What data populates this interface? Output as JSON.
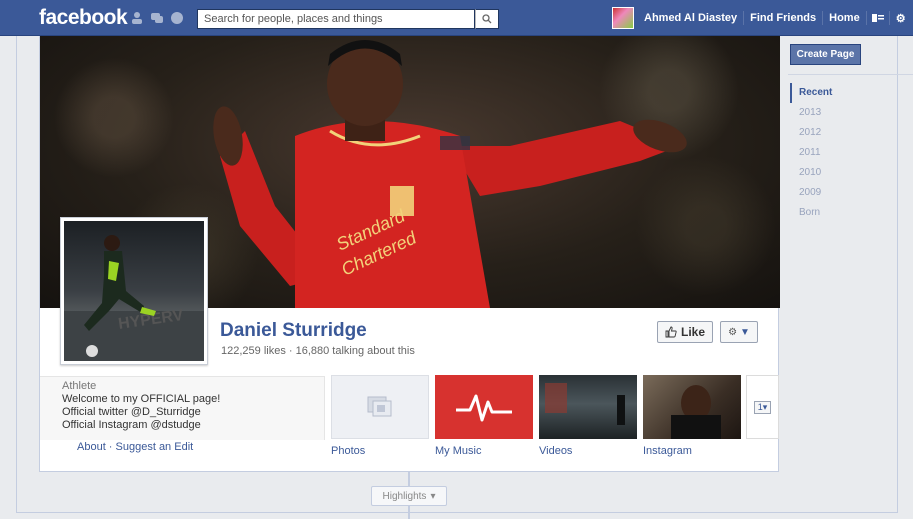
{
  "header": {
    "logo": "facebook",
    "search_placeholder": "Search for people, places and things",
    "user_name": "Ahmed Al Diastey",
    "find_friends": "Find Friends",
    "home": "Home"
  },
  "page": {
    "name": "Daniel Sturridge",
    "stats": "122,259 likes · 16,880 talking about this",
    "like_label": "Like",
    "category": "Athlete",
    "about_lines": [
      "Welcome to my OFFICIAL page!",
      "Official twitter @D_Sturridge",
      "Official Instagram @dstudge"
    ],
    "about_links": "About · Suggest an Edit"
  },
  "apps": [
    {
      "label": "Photos"
    },
    {
      "label": "My Music"
    },
    {
      "label": "Videos"
    },
    {
      "label": "Instagram"
    }
  ],
  "apps_more": "1",
  "highlights": "Highlights",
  "sidebar": {
    "create_page": "Create Page",
    "years": [
      "Recent",
      "2013",
      "2012",
      "2011",
      "2010",
      "2009",
      "Born"
    ]
  },
  "colors": {
    "brand_blue": "#3b5998",
    "music_red": "#d7322f"
  }
}
